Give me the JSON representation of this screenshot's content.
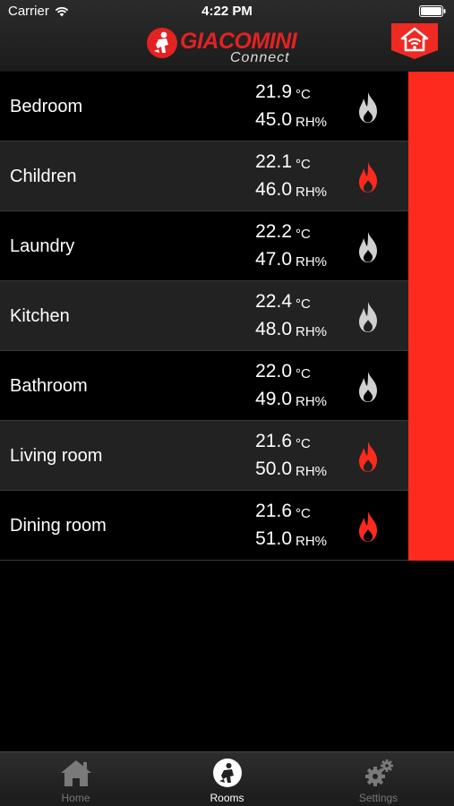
{
  "status_bar": {
    "carrier": "Carrier",
    "time": "4:22 PM"
  },
  "header": {
    "logo_text": "GIACOMINI",
    "logo_sub": "Connect",
    "brand_color": "#e32222"
  },
  "rooms": [
    {
      "name": "Bedroom",
      "temp": "21.9",
      "temp_unit": "°C",
      "humidity": "45.0",
      "hum_unit": "RH%",
      "heating": false
    },
    {
      "name": "Children",
      "temp": "22.1",
      "temp_unit": "°C",
      "humidity": "46.0",
      "hum_unit": "RH%",
      "heating": true
    },
    {
      "name": "Laundry",
      "temp": "22.2",
      "temp_unit": "°C",
      "humidity": "47.0",
      "hum_unit": "RH%",
      "heating": false
    },
    {
      "name": "Kitchen",
      "temp": "22.4",
      "temp_unit": "°C",
      "humidity": "48.0",
      "hum_unit": "RH%",
      "heating": false
    },
    {
      "name": "Bathroom",
      "temp": "22.0",
      "temp_unit": "°C",
      "humidity": "49.0",
      "hum_unit": "RH%",
      "heating": false
    },
    {
      "name": "Living room",
      "temp": "21.6",
      "temp_unit": "°C",
      "humidity": "50.0",
      "hum_unit": "RH%",
      "heating": true
    },
    {
      "name": "Dining room",
      "temp": "21.6",
      "temp_unit": "°C",
      "humidity": "51.0",
      "hum_unit": "RH%",
      "heating": true
    }
  ],
  "colors": {
    "flame_active": "#ff2a1e",
    "flame_inactive": "#d0d0d0",
    "strip": "#ff2a1e"
  },
  "tabbar": {
    "tabs": [
      {
        "label": "Home",
        "icon": "home-icon",
        "active": false
      },
      {
        "label": "Rooms",
        "icon": "rooms-icon",
        "active": true
      },
      {
        "label": "Settings",
        "icon": "gear-icon",
        "active": false
      }
    ]
  }
}
